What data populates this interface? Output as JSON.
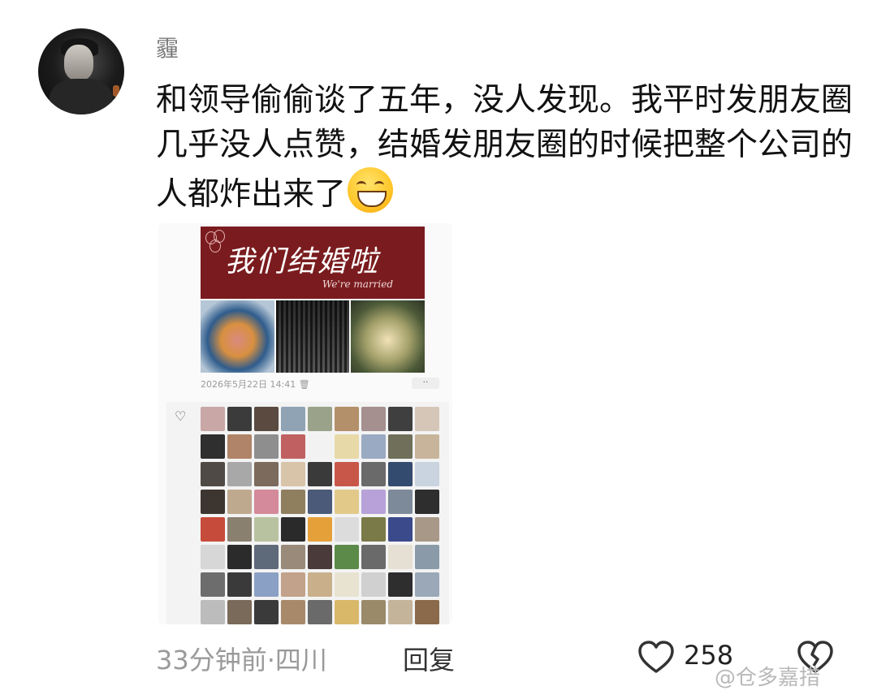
{
  "author": {
    "name": "霾"
  },
  "post": {
    "text": "和领导偷偷谈了五年，没人发现。我平时发朋友圈几乎没人点赞，结婚发朋友圈的时候把整个公司的人都炸出来了",
    "emoji": "grinning-face-emoji"
  },
  "screenshot": {
    "banner_title": "我们结婚啦",
    "banner_subtitle": "We're married",
    "timestamp": "2026年5月22日 14:41",
    "more_label": "··",
    "like_icon": "heart-outline-icon",
    "liker_colors": [
      "#c9a7a7",
      "#3b3b3b",
      "#5a4a40",
      "#8fa3b5",
      "#9aa38a",
      "#b38f6a",
      "#a58f8f",
      "#3f3f3f",
      "#d5c6b8",
      "#2f2f2f",
      "#b08468",
      "#8e8e8e",
      "#c06060",
      "#f2f2f2",
      "#e8d9a8",
      "#9aaac2",
      "#6f6f5a",
      "#c7b49a",
      "#4f4a45",
      "#a8a8a8",
      "#7c6a5c",
      "#d8c4a8",
      "#3a3a3a",
      "#c8574a",
      "#6a6a6a",
      "#334b6e",
      "#c9d4e0",
      "#3d3530",
      "#bfa98e",
      "#d48a9a",
      "#8f7f5e",
      "#4a5a78",
      "#e2c98a",
      "#b7a1d8",
      "#7d8a9a",
      "#2e2e2e",
      "#c74b3a",
      "#8a8070",
      "#b9c2a0",
      "#2a2a2a",
      "#e6a03a",
      "#dcdcdc",
      "#7a7a48",
      "#3b4a8a",
      "#a89888",
      "#d7d7d7",
      "#2b2b2b",
      "#5e6a7a",
      "#9a8a7a",
      "#4a3a3a",
      "#5c8a48",
      "#6a6a6a",
      "#e6e0d4",
      "#8a9aa8",
      "#6d6d6d",
      "#3a3a3a",
      "#8aa0c4",
      "#c2a28a",
      "#c9b08a",
      "#e8e2d0",
      "#d0d0d0",
      "#2e2e2e",
      "#9aa8b8",
      "#bcbcbc",
      "#7a6a5a",
      "#3a3a3a",
      "#a88a6a",
      "#6a6a6a",
      "#d9b86a",
      "#9a8a6a",
      "#c4b49a",
      "#8a6a4a"
    ]
  },
  "footer": {
    "time_location": "33分钟前·四川",
    "reply_label": "回复",
    "like_count": "258",
    "like_icon": "heart-outline-icon",
    "dislike_icon": "broken-heart-icon",
    "watermark": "@仓多嘉措"
  }
}
